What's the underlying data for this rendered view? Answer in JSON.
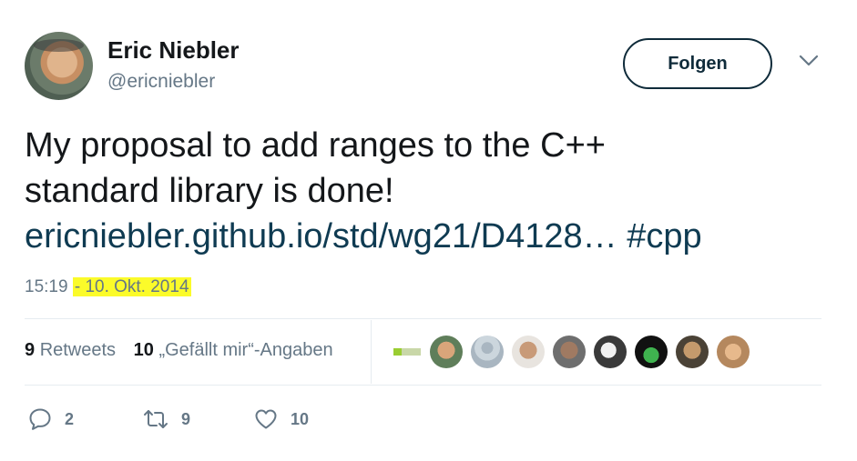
{
  "author": {
    "name": "Eric Niebler",
    "handle": "@ericniebler"
  },
  "follow_label": "Folgen",
  "tweet": {
    "line1": "My proposal to add ranges to the C++",
    "line2": "standard library is done!",
    "link": "ericniebler.github.io/std/wg21/D4128…",
    "hashtag": "#cpp"
  },
  "meta": {
    "time": "15:19",
    "separator": "-",
    "date": "10. Okt. 2014"
  },
  "stats": {
    "retweets_count": "9",
    "retweets_label": "Retweets",
    "likes_count": "10",
    "likes_label": "„Gefällt mir“-Angaben"
  },
  "actions": {
    "reply_count": "2",
    "retweet_count": "9",
    "like_count": "10"
  },
  "colors": {
    "link": "#0f3b52",
    "highlight": "#fbfb2a",
    "muted": "#657786"
  },
  "icons": [
    "chevron-down-icon",
    "reply-icon",
    "retweet-icon",
    "heart-icon"
  ]
}
